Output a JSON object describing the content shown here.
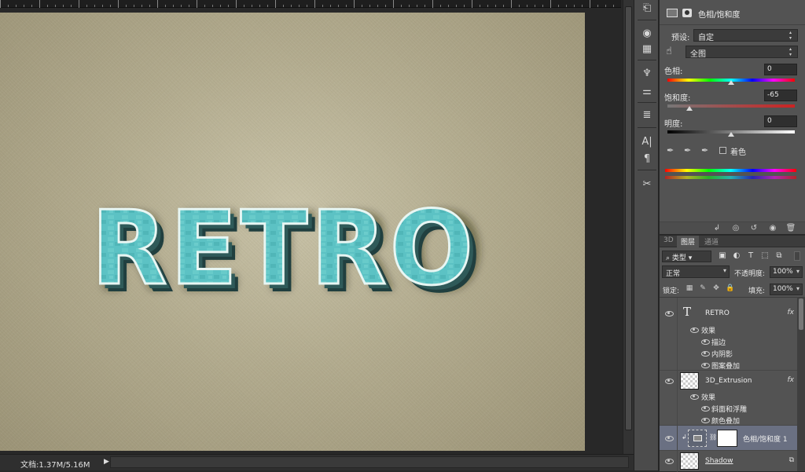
{
  "canvas": {
    "headline": "RETRO",
    "colors": {
      "background": "#b4ad91",
      "text_face": "#5dc4c7",
      "text_stroke": "#e6f4f2",
      "extrusion": "#294b4b"
    }
  },
  "status": {
    "doc_size": "文档:1.37M/5.16M"
  },
  "tools": [
    "history-icon",
    "palette-icon",
    "grid-icon",
    "brush-preset-icon",
    "adjust-icon",
    "clone-icon",
    "text-icon",
    "paragraph-icon",
    "tools-icon"
  ],
  "properties": {
    "title": "色相/饱和度",
    "preset_label": "预设:",
    "preset_value": "自定",
    "channel_value": "全图",
    "hue_label": "色相:",
    "hue_value": "0",
    "saturation_label": "饱和度:",
    "saturation_value": "-65",
    "lightness_label": "明度:",
    "lightness_value": "0",
    "colorize_label": "着色"
  },
  "layers_panel": {
    "tabs": [
      "3D",
      "图层",
      "通道"
    ],
    "kind_filter": "类型",
    "blend_mode": "正常",
    "opacity_label": "不透明度:",
    "opacity_value": "100%",
    "lock_label": "锁定:",
    "fill_label": "填充:",
    "fill_value": "100%",
    "layers": [
      {
        "name": "RETRO",
        "fx": "fx",
        "effects_label": "效果",
        "effects": [
          "描边",
          "内阴影",
          "图案叠加"
        ]
      },
      {
        "name": "3D_Extrusion",
        "fx": "fx",
        "effects_label": "效果",
        "effects": [
          "斜面和浮雕",
          "颜色叠加"
        ]
      },
      {
        "name": "色相/饱和度 1"
      },
      {
        "name": "Shadow"
      }
    ]
  }
}
